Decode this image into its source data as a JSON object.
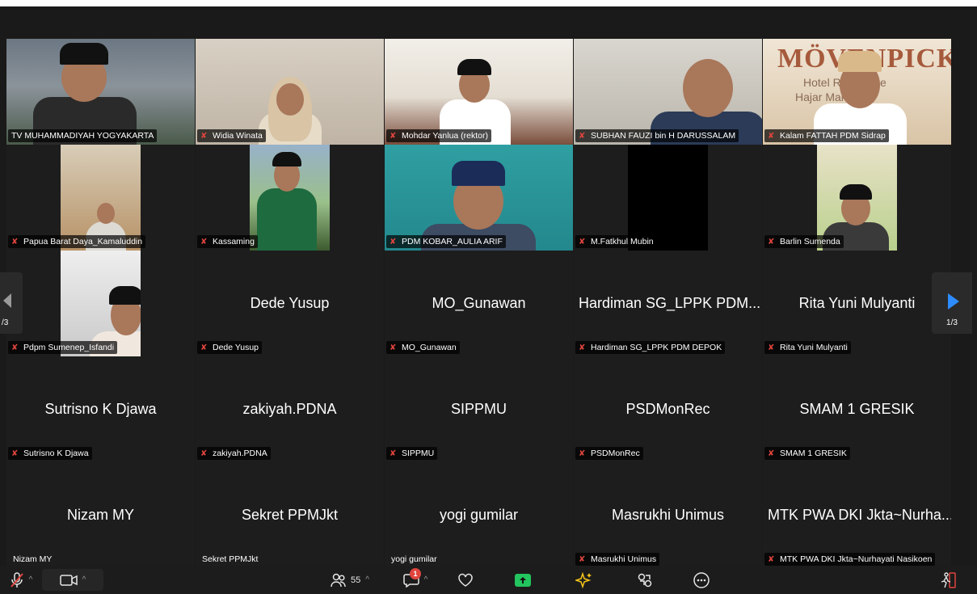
{
  "colors": {
    "background": "#1a1a1a",
    "active_border": "#25c14a",
    "muted_icon": "#e0453e",
    "arrow_blue": "#2d8cff",
    "share_green": "#23c55e"
  },
  "participants": [
    {
      "label": "TV MUHAMMADIYAH YOGYAKARTA",
      "muted": false,
      "video": "full",
      "bg": "bg-sky",
      "active": true
    },
    {
      "label": "Widia Winata",
      "muted": true,
      "video": "full",
      "bg": "bg-wall"
    },
    {
      "label": "Mohdar Yanlua (rektor)",
      "muted": true,
      "video": "full",
      "bg": "bg-sofa"
    },
    {
      "label": "SUBHAN FAUZI bin H DARUSSALAM",
      "muted": true,
      "video": "full",
      "bg": "bg-room"
    },
    {
      "label": "Kalam FATTAH PDM Sidrap",
      "muted": true,
      "video": "full",
      "bg": "bg-hotel",
      "sign": "MÖVENPICK",
      "sign_sub1": "Hotel  Residence",
      "sign_sub2": "Hajar  Makkah"
    },
    {
      "label": "Papua Barat Daya_Kamaluddin",
      "muted": true,
      "video": "narrow",
      "bg": "bg-office"
    },
    {
      "label": "Kassaming",
      "muted": true,
      "video": "narrow",
      "bg": "bg-hill"
    },
    {
      "label": "PDM KOBAR_AULIA ARIF",
      "muted": true,
      "video": "full",
      "bg": "bg-teal"
    },
    {
      "label": "M.Fatkhul Mubin",
      "muted": true,
      "video": "narrow",
      "bg": "bg-black"
    },
    {
      "label": "Barlin Sumenda",
      "muted": true,
      "video": "narrow",
      "bg": "bg-green"
    },
    {
      "label": "Pdpm Sumenep_Isfandi",
      "muted": true,
      "video": "narrow",
      "bg": "bg-white"
    },
    {
      "label": "Dede Yusup",
      "name": "Dede Yusup",
      "muted": true
    },
    {
      "label": "MO_Gunawan",
      "name": "MO_Gunawan",
      "muted": true
    },
    {
      "label": "Hardiman SG_LPPK PDM DEPOK",
      "name": "Hardiman SG_LPPK PDM...",
      "muted": true
    },
    {
      "label": "Rita Yuni Mulyanti",
      "name": "Rita Yuni Mulyanti",
      "muted": true
    },
    {
      "label": "Sutrisno K Djawa",
      "name": "Sutrisno K Djawa",
      "muted": true
    },
    {
      "label": "zakiyah.PDNA",
      "name": "zakiyah.PDNA",
      "muted": true
    },
    {
      "label": "SIPPMU",
      "name": "SIPPMU",
      "muted": true
    },
    {
      "label": "PSDMonRec",
      "name": "PSDMonRec",
      "muted": true
    },
    {
      "label": "SMAM 1 GRESIK",
      "name": "SMAM 1 GRESIK",
      "muted": true
    },
    {
      "label": "Nizam MY",
      "name": "Nizam MY",
      "muted": false
    },
    {
      "label": "Sekret PPMJkt",
      "name": "Sekret PPMJkt",
      "muted": false
    },
    {
      "label": "yogi gumilar",
      "name": "yogi gumilar",
      "muted": false
    },
    {
      "label": "Masrukhi Unimus",
      "name": "Masrukhi Unimus",
      "muted": true
    },
    {
      "label": "MTK PWA DKI Jkta~Nurhayati Nasikoen",
      "name": "MTK PWA DKI Jkta~Nurha...",
      "muted": true
    }
  ],
  "pager": {
    "left_label": "/3",
    "right_label": "1/3"
  },
  "toolbar": {
    "participants_count": "55",
    "chat_badge": "1"
  }
}
